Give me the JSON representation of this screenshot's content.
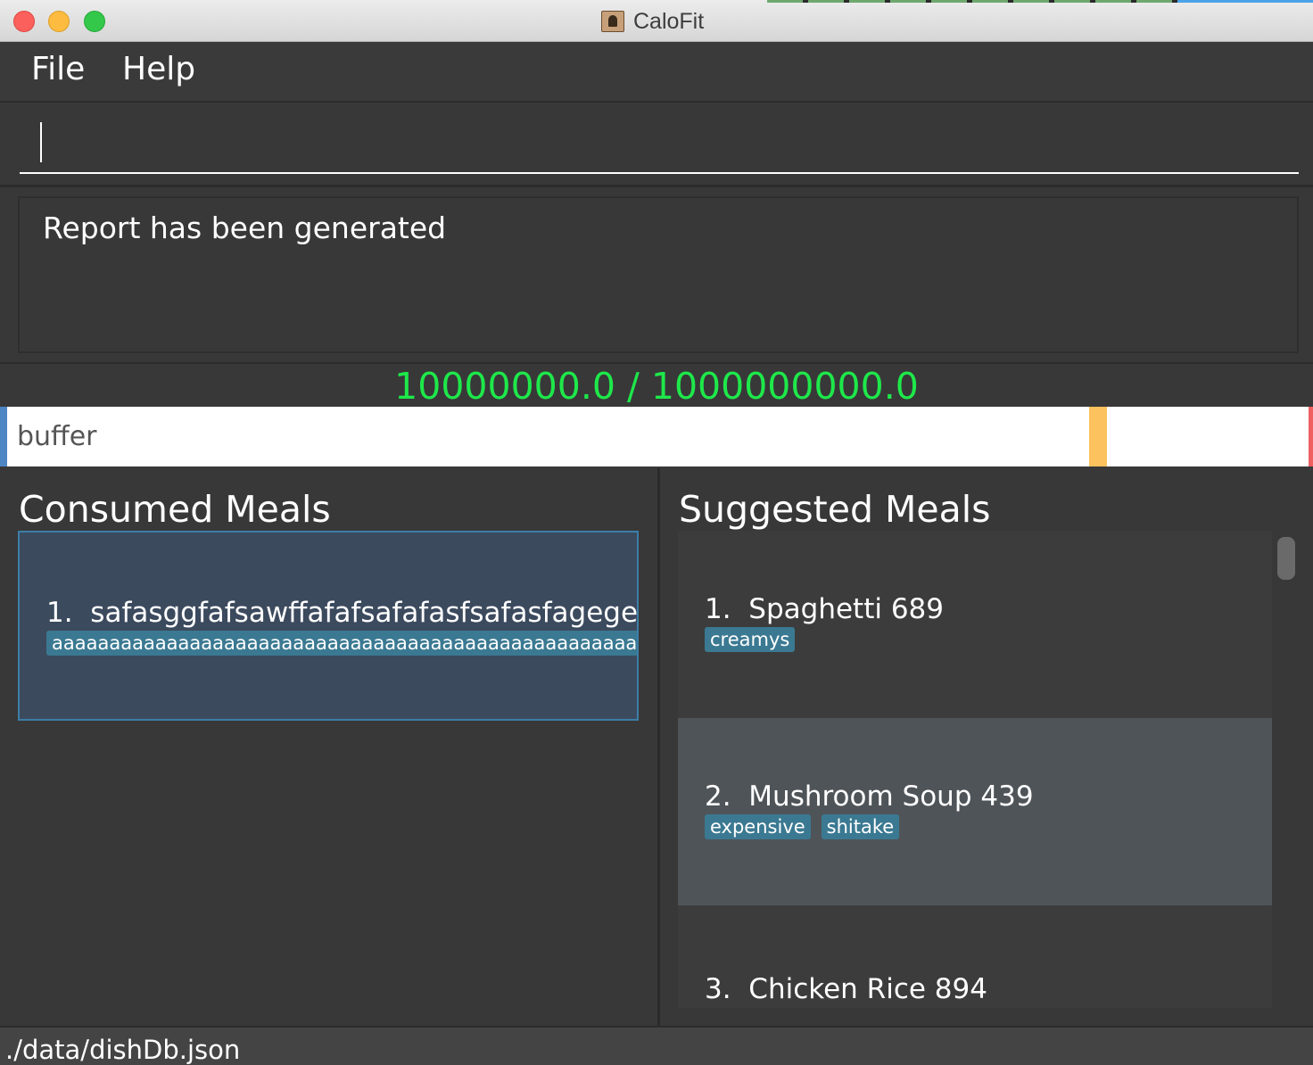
{
  "window": {
    "title": "CaloFit"
  },
  "menu": {
    "file": "File",
    "help": "Help"
  },
  "command": {
    "value": ""
  },
  "result": {
    "text": "Report has been generated"
  },
  "calorie": {
    "text": "10000000.0 / 1000000000.0"
  },
  "progress": {
    "label": "buffer"
  },
  "consumed": {
    "title": "Consumed Meals",
    "items": [
      {
        "index": "1.",
        "name": "safasggfafsawffafafsafafasfsafasfagegegegegegeg",
        "tags": [
          "aaaaaaaaaaaaaaaaaaaaaaaaaaaaaaaaaaaaaaaaaaaaaaaaaaaaaaaaaaaa"
        ]
      }
    ]
  },
  "suggested": {
    "title": "Suggested Meals",
    "items": [
      {
        "index": "1.",
        "name": "Spaghetti",
        "calories": "689",
        "tags": [
          "creamys"
        ]
      },
      {
        "index": "2.",
        "name": "Mushroom Soup",
        "calories": "439",
        "tags": [
          "expensive",
          "shitake"
        ]
      },
      {
        "index": "3.",
        "name": "Chicken Rice",
        "calories": "894",
        "tags": []
      }
    ]
  },
  "status": {
    "path": "./data/dishDb.json"
  },
  "colors": {
    "calorie_text": "#1ee84a",
    "tag_bg": "#3b7992",
    "selected_card": "#3c4a5e",
    "progress_marker": "#fbc25d"
  }
}
